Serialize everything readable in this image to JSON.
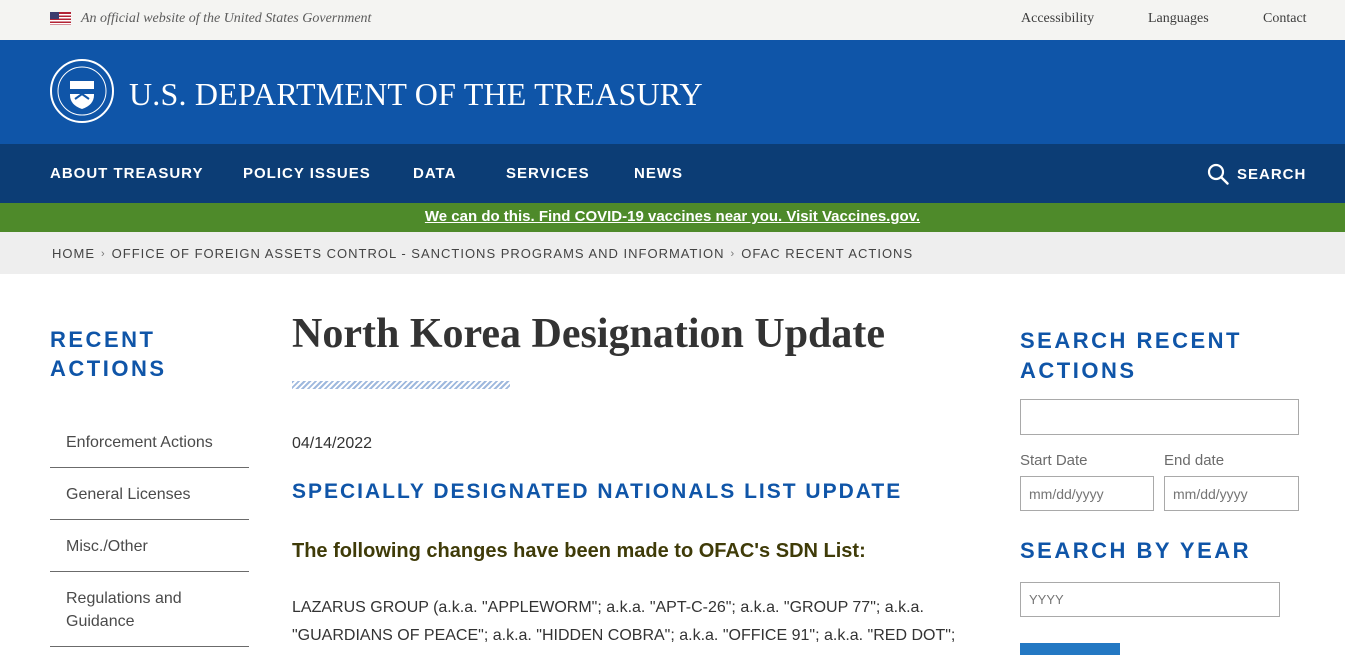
{
  "gov_banner": {
    "official_text": "An official website of the United States Government",
    "links": [
      "Accessibility",
      "Languages",
      "Contact"
    ]
  },
  "header": {
    "site_title": "U.S. DEPARTMENT OF THE TREASURY"
  },
  "nav": {
    "items": [
      "ABOUT TREASURY",
      "POLICY ISSUES",
      "DATA",
      "SERVICES",
      "NEWS"
    ],
    "search_label": "SEARCH"
  },
  "alert": {
    "text": "We can do this. Find COVID-19 vaccines near you. Visit Vaccines.gov."
  },
  "breadcrumb": {
    "items": [
      "HOME",
      "OFFICE OF FOREIGN ASSETS CONTROL - SANCTIONS PROGRAMS AND INFORMATION",
      "OFAC RECENT ACTIONS"
    ]
  },
  "sidebar": {
    "title_line1": "RECENT",
    "title_line2": "ACTIONS",
    "items": [
      "Enforcement Actions",
      "General Licenses",
      "Misc./Other",
      "Regulations and Guidance"
    ]
  },
  "main": {
    "title": "North Korea Designation Update",
    "date": "04/14/2022",
    "section_heading": "SPECIALLY DESIGNATED NATIONALS LIST UPDATE",
    "sub_heading": "The following changes have been made to OFAC's SDN List:",
    "body_line1": "LAZARUS GROUP (a.k.a. \"APPLEWORM\"; a.k.a. \"APT-C-26\"; a.k.a. \"GROUP 77\"; a.k.a.",
    "body_line2": "\"GUARDIANS OF PEACE\"; a.k.a. \"HIDDEN COBRA\"; a.k.a. \"OFFICE 91\"; a.k.a. \"RED DOT\"; a.k.a."
  },
  "right_sidebar": {
    "search_title_line1": "SEARCH RECENT",
    "search_title_line2": "ACTIONS",
    "keyword_value": "",
    "start_date_label": "Start Date",
    "end_date_label": "End date",
    "start_date_placeholder": "mm/dd/yyyy",
    "end_date_placeholder": "mm/dd/yyyy",
    "year_title": "SEARCH BY YEAR",
    "year_placeholder": "YYYY"
  },
  "colors": {
    "header_blue": "#0f55a8",
    "nav_blue": "#0c3d75",
    "alert_green": "#4e8a2a"
  }
}
